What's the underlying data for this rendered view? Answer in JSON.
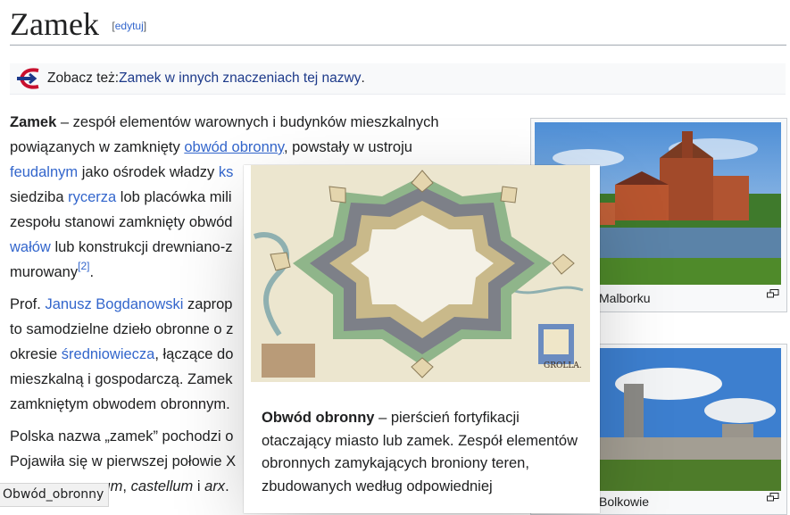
{
  "heading": {
    "title": "Zamek",
    "edit_open": "[",
    "edit_link": "edytuj",
    "edit_close": "]"
  },
  "hatnote": {
    "prefix": "Zobacz też: ",
    "link": "Zamek w innych znaczeniach tej nazwy",
    "suffix": "."
  },
  "article": {
    "p1": {
      "bold": "Zamek",
      "t1": " – zespół elementów warownych i budynków mieszkalnych powiązanych w zamknięty ",
      "link1": "obwód obronny",
      "t2": ", powstały w ustroju ",
      "link2": "feudalnym",
      "t3": " jako ośrodek władzy ",
      "link3": "ks",
      "t4": "",
      "line3": "siedziba ",
      "link4": "rycerza",
      "t5": " lob placówka mili",
      "line4": "zespołu stanowi zamknięty obwód",
      "link5": "wałów",
      "t6": " lub konstrukcji drewniano-z",
      "line6": "murowany",
      "ref": "[2]",
      "end": "."
    },
    "p2": {
      "t1": "Prof. ",
      "link1": "Janusz Bogdanowski",
      "t2": " zaprop",
      "line2": "to samodzielne dzieło obronne o z",
      "t3": "okresie ",
      "link2": "średniowiecza",
      "t4": ", łączące do",
      "line4": "mieszkalną i gospodarczą. Zamek",
      "line5": "zamkniętym obwodem obronnym."
    },
    "p3": {
      "line1": "Polska nazwa „zamek” pochodzi o",
      "line2": "Pojawiła się w pierwszej połowie X",
      "line3a": "rum",
      "line3b": ", ",
      "line3c": "castellum",
      "line3d": " i ",
      "line3e": "arx",
      "line3f": "."
    }
  },
  "thumbs": [
    {
      "caption": "Malborku"
    },
    {
      "caption": "Bolkowie"
    }
  ],
  "popup": {
    "bold": "Obwód obronny",
    "text": " – pierścień fortyfikacji otaczający miasto lub zamek. Zespół elementów obronnych zamykających broniony teren, zbudowanych według odpowiedniej",
    "map_label": "GROLLA."
  },
  "status_bar": {
    "text": "Obwód_obronny"
  },
  "colors": {
    "link": "#3366cc",
    "text": "#202122",
    "hatnote_bg": "#f8f9fa"
  }
}
